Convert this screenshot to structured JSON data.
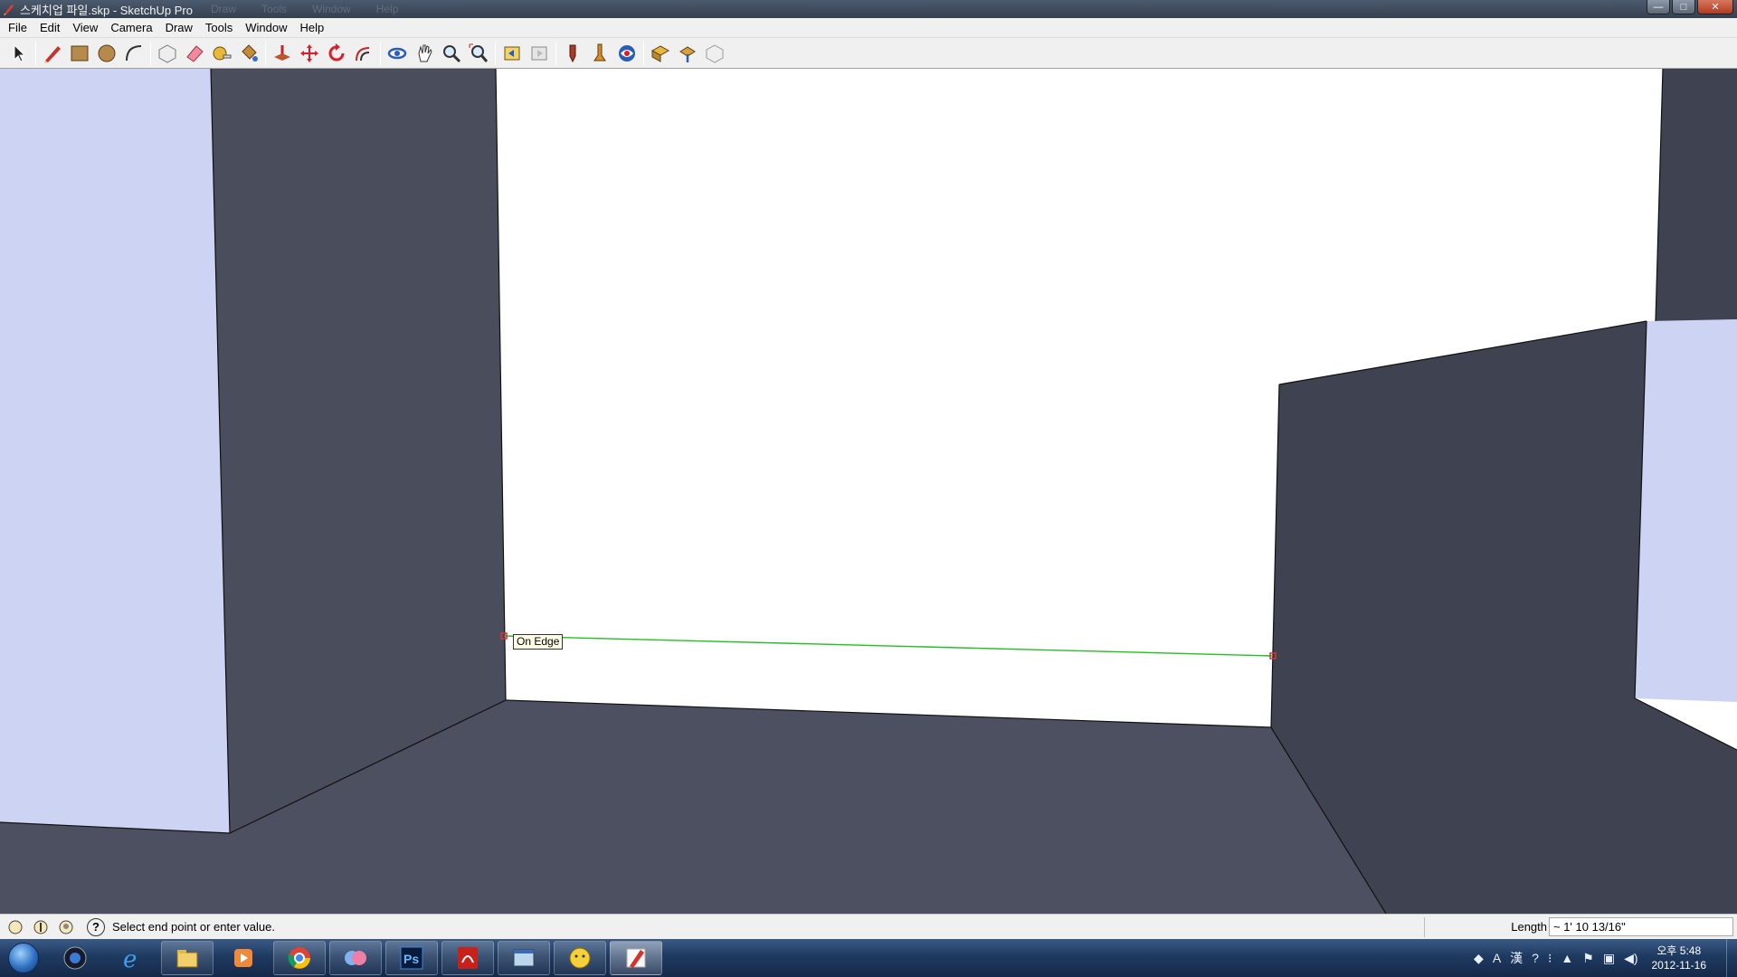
{
  "window": {
    "title": "스케치업 파일.skp - SketchUp Pro",
    "ghost_menu": [
      "Draw",
      "Tools",
      "Window",
      "Help"
    ],
    "buttons": {
      "minimize": "—",
      "maximize": "□",
      "close": "✕"
    }
  },
  "menubar": {
    "items": [
      "File",
      "Edit",
      "View",
      "Camera",
      "Draw",
      "Tools",
      "Window",
      "Help"
    ]
  },
  "toolbar": {
    "groups": [
      [
        "select-icon"
      ],
      [
        "pencil-line-icon",
        "rectangle-icon",
        "circle-icon",
        "arc-icon"
      ],
      [
        "make-component-icon",
        "eraser-icon",
        "tape-measure-icon",
        "paint-bucket-icon"
      ],
      [
        "push-pull-icon",
        "move-icon",
        "rotate-icon",
        "offset-icon"
      ],
      [
        "orbit-icon",
        "pan-icon",
        "zoom-icon",
        "zoom-extents-icon"
      ],
      [
        "previous-view-icon",
        "next-view-icon"
      ],
      [
        "position-camera-icon",
        "walk-icon",
        "look-around-icon"
      ],
      [
        "get-models-icon",
        "share-model-icon",
        "share-component-icon"
      ]
    ]
  },
  "viewport": {
    "inference_tooltip": "On Edge",
    "colors": {
      "dark_face": "#4a4d5c",
      "darker_face": "#3f4250",
      "floor": "#4d5060",
      "light_face": "#cdd3f3",
      "white_face": "#ffffff",
      "inference_line": "#22c022",
      "endpoint": "#e03030"
    }
  },
  "statusbar": {
    "status_text": "Select end point or enter value.",
    "vcb_label": "Length",
    "vcb_value": "~ 1' 10 13/16\""
  },
  "taskbar": {
    "apps": [
      "media-center-icon",
      "internet-explorer-icon",
      "file-explorer-icon",
      "media-player-icon",
      "chrome-icon",
      "messenger-icon",
      "photoshop-icon",
      "acrobat-icon",
      "window-app-icon",
      "chat-app-icon",
      "sketchup-icon"
    ],
    "photoshop_label": "Ps",
    "tray": {
      "ime_a": "A",
      "ime_han": "漢",
      "help": "?",
      "time": "오후 5:48",
      "date": "2012-11-16"
    }
  }
}
